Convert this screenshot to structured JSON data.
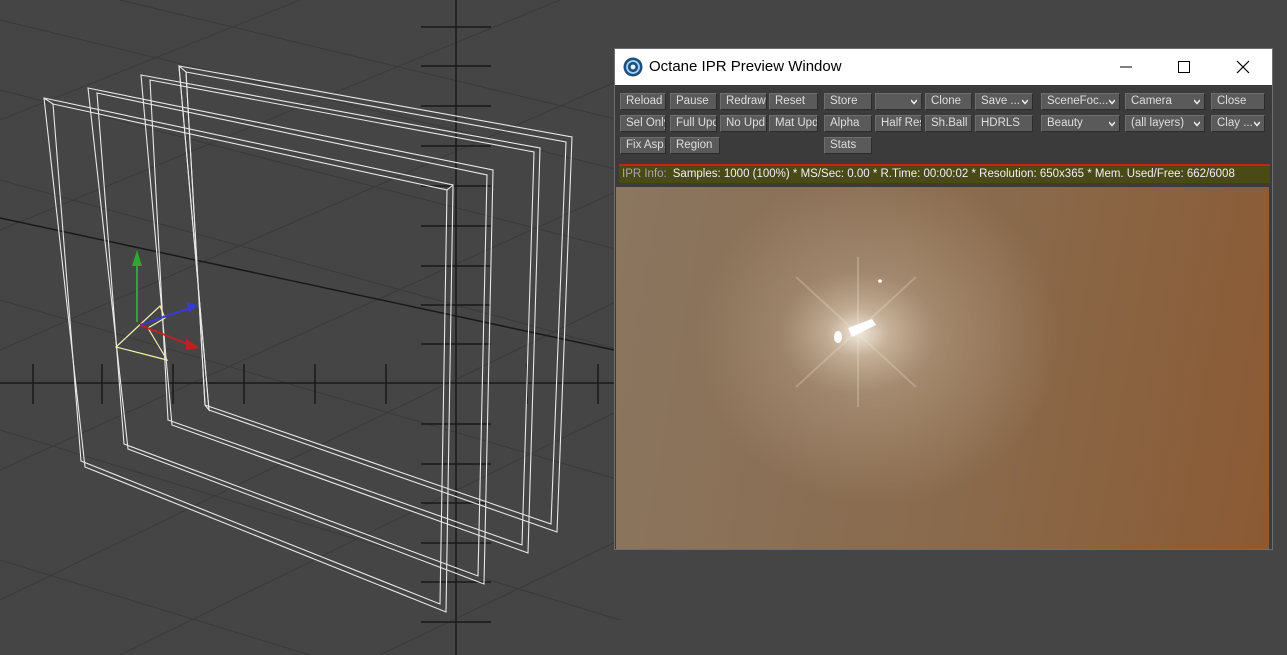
{
  "window": {
    "title": "Octane IPR Preview Window",
    "icons": {
      "app": "octane-logo-icon",
      "minimize": "minimize-icon",
      "maximize": "maximize-icon",
      "close": "close-icon"
    }
  },
  "toolbar": {
    "reload": "Reload",
    "pause": "Pause",
    "redraw": "Redraw",
    "reset": "Reset",
    "store": "Store",
    "store_slot": "",
    "clone": "Clone",
    "save": "Save ...",
    "scene_focus": "SceneFoc...",
    "camera": "Camera",
    "close": "Close",
    "sel_only": "Sel Only",
    "full_upd": "Full Upd.",
    "no_upd": "No Upd.",
    "mat_upd": "Mat Upd",
    "alpha": "Alpha",
    "half_res": "Half Res",
    "sh_ball": "Sh.Ball",
    "hdrls": "HDRLS",
    "pass": "Beauty",
    "layers": "(all layers)",
    "clay": "Clay ...",
    "fix_asp": "Fix Asp.",
    "region": "Region",
    "stats": "Stats"
  },
  "status": {
    "label": "IPR Info:",
    "text": "Samples: 1000 (100%)  *  MS/Sec: 0.00  *  R.Time: 00:00:02  *  Resolution: 650x365  *  Mem. Used/Free: 662/6008"
  },
  "colors": {
    "viewport_bg": "#454545",
    "status_bar_bg": "#4a4a16",
    "status_border": "#c0261c",
    "render_tint": "#8b5a33"
  }
}
